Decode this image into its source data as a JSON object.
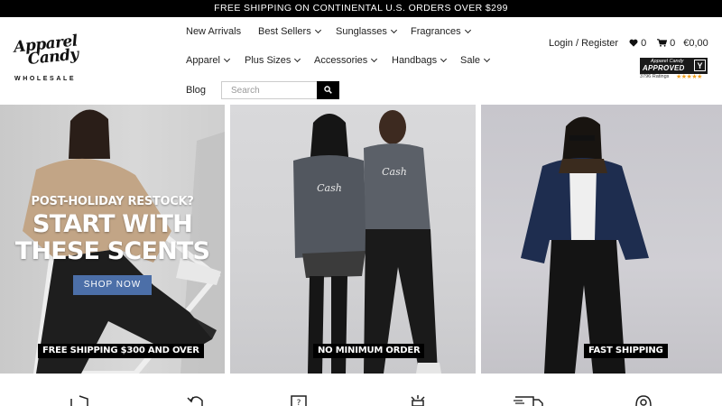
{
  "announcement": "FREE SHIPPING ON CONTINENTAL U.S. ORDERS OVER $299",
  "logo": {
    "script_line1": "Apparel",
    "script_line2": "Candy",
    "subtitle": "WHOLESALE"
  },
  "nav": {
    "row1": [
      {
        "label": "New Arrivals",
        "dropdown": false
      },
      {
        "label": "Best Sellers",
        "dropdown": true
      },
      {
        "label": "Sunglasses",
        "dropdown": true
      },
      {
        "label": "Fragrances",
        "dropdown": true
      }
    ],
    "row2": [
      {
        "label": "Apparel",
        "dropdown": true
      },
      {
        "label": "Plus Sizes",
        "dropdown": true
      },
      {
        "label": "Accessories",
        "dropdown": true
      },
      {
        "label": "Handbags",
        "dropdown": true
      },
      {
        "label": "Sale",
        "dropdown": true
      }
    ],
    "row3": [
      {
        "label": "Blog",
        "dropdown": false
      }
    ]
  },
  "search": {
    "placeholder": "Search"
  },
  "account": {
    "login_label": "Login / Register",
    "wishlist_count": "0",
    "cart_count": "0",
    "cart_total": "€0,00"
  },
  "shopper_badge": {
    "brand": "Apparel Candy",
    "title": "APPROVED",
    "ratings": "3796 Ratings",
    "stars": "★★★★★"
  },
  "hero": {
    "panel1": {
      "kicker": "POST-HOLIDAY RESTOCK?",
      "headline_line1": "START WITH",
      "headline_line2": "THESE SCENTS",
      "button": "SHOP NOW",
      "caption": "FREE SHIPPING $300 AND OVER"
    },
    "panel2": {
      "caption": "NO MINIMUM ORDER"
    },
    "panel3": {
      "caption": "FAST SHIPPING"
    }
  },
  "colors": {
    "topbar": "#000000",
    "button_blue": "#4c6fa8",
    "star": "#f0a020"
  },
  "feature_icons": [
    "shield-icon",
    "return-icon",
    "question-icon",
    "badge-icon",
    "truck-icon",
    "support-icon"
  ]
}
